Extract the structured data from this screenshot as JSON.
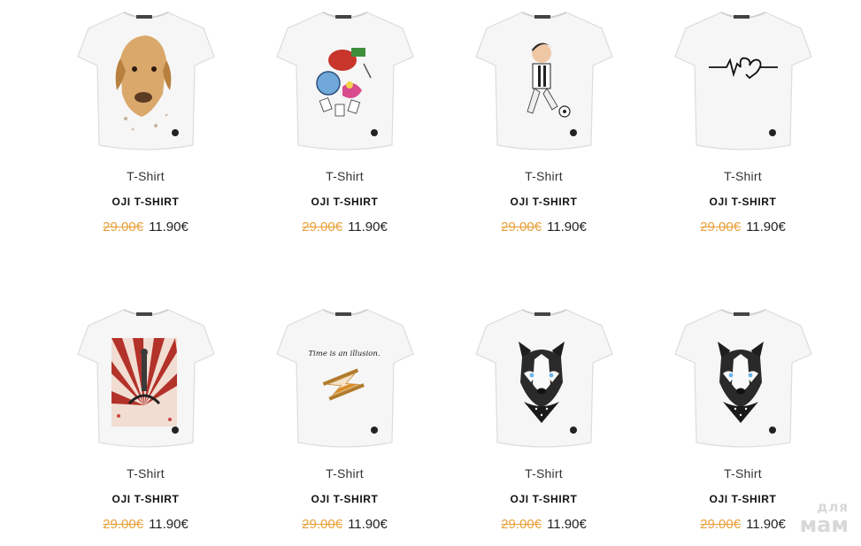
{
  "products": [
    {
      "category": "T-Shirt",
      "title": "OJI T-SHIRT",
      "old_price": "29.00€",
      "price": "11.90€",
      "print": "golden-retriever-print"
    },
    {
      "category": "T-Shirt",
      "title": "OJI T-SHIRT",
      "old_price": "29.00€",
      "price": "11.90€",
      "print": "teapot-clock-cards-print"
    },
    {
      "category": "T-Shirt",
      "title": "OJI T-SHIRT",
      "old_price": "29.00€",
      "price": "11.90€",
      "print": "soccer-player-print"
    },
    {
      "category": "T-Shirt",
      "title": "OJI T-SHIRT",
      "old_price": "29.00€",
      "price": "11.90€",
      "print": "heartbeat-line-print"
    },
    {
      "category": "T-Shirt",
      "title": "OJI T-SHIRT",
      "old_price": "29.00€",
      "price": "11.90€",
      "print": "sunburst-figure-print"
    },
    {
      "category": "T-Shirt",
      "title": "OJI T-SHIRT",
      "old_price": "29.00€",
      "price": "11.90€",
      "print": "hourglass-print",
      "print_text": "Time is an illusion."
    },
    {
      "category": "T-Shirt",
      "title": "OJI T-SHIRT",
      "old_price": "29.00€",
      "price": "11.90€",
      "print": "husky-print"
    },
    {
      "category": "T-Shirt",
      "title": "OJI T-SHIRT",
      "old_price": "29.00€",
      "price": "11.90€",
      "print": "husky-print"
    }
  ],
  "watermark": {
    "line1": "для",
    "line2": "мам"
  },
  "colors": {
    "old_price": "#e8a03a",
    "text": "#222222",
    "shirt": "#f7f7f7"
  }
}
